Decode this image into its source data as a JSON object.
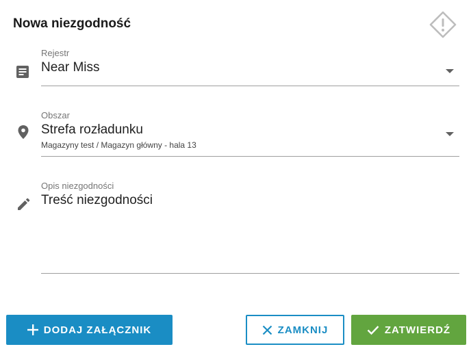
{
  "dialog": {
    "title": "Nowa niezgodność"
  },
  "icons": {
    "header": "warning-diamond-icon",
    "register": "document-lines-icon",
    "area": "location-pin-icon",
    "description": "pencil-icon"
  },
  "fields": {
    "register": {
      "label": "Rejestr",
      "value": "Near Miss"
    },
    "area": {
      "label": "Obszar",
      "value": "Strefa rozładunku",
      "sub": "Magazyny test / Magazyn główny - hala 13"
    },
    "description": {
      "label": "Opis niezgodności",
      "value": "Treść niezgodności"
    }
  },
  "buttons": {
    "attach": "DODAJ ZAŁĄCZNIK",
    "close": "ZAMKNIJ",
    "confirm": "ZATWIERDŹ"
  },
  "colors": {
    "primary": "#1a8dc4",
    "success": "#62a53f",
    "icon": "#616161"
  }
}
